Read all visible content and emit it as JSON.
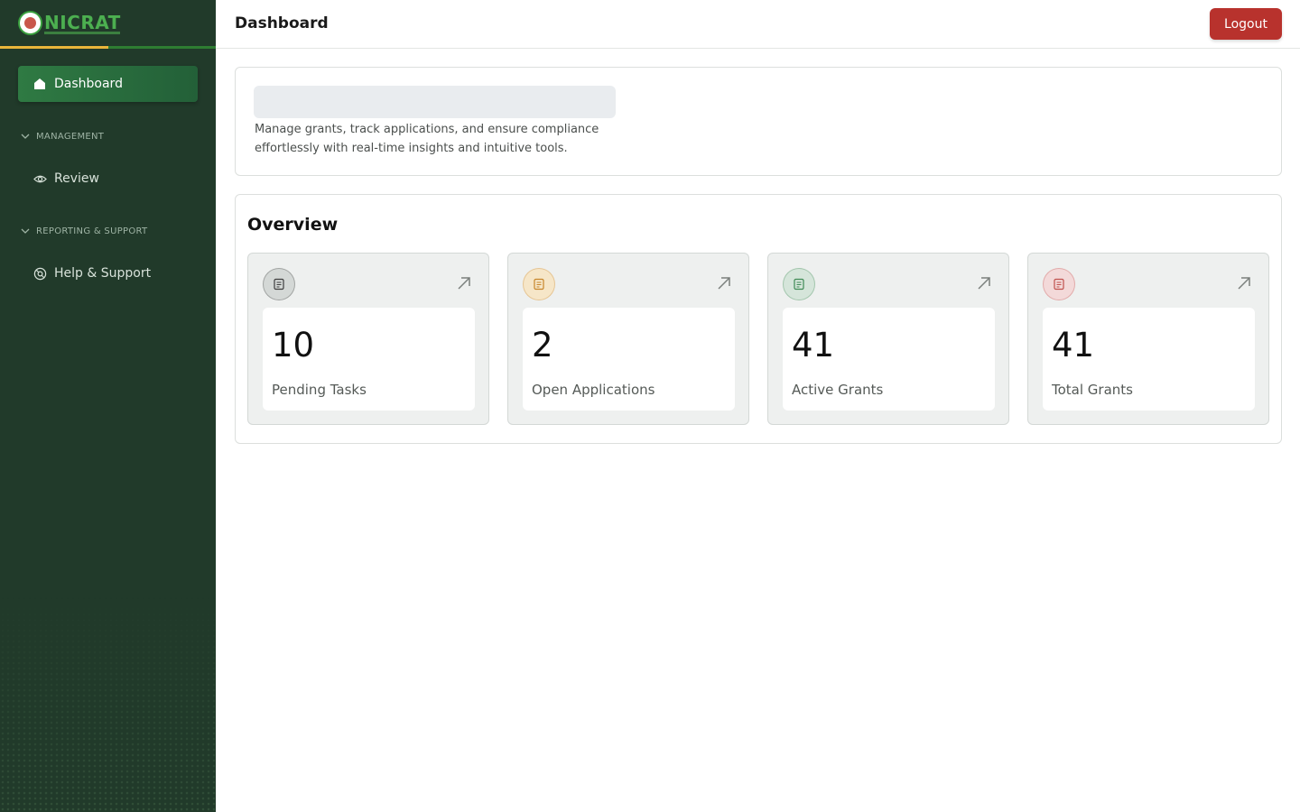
{
  "brand": {
    "name": "NICRAT"
  },
  "sidebar": {
    "active_item": {
      "label": "Dashboard",
      "icon": "home-icon"
    },
    "sections": [
      {
        "title": "MANAGEMENT",
        "items": [
          {
            "label": "Review",
            "icon": "eye-icon"
          }
        ]
      },
      {
        "title": "REPORTING & SUPPORT",
        "items": [
          {
            "label": "Help & Support",
            "icon": "support-icon"
          }
        ]
      }
    ]
  },
  "header": {
    "title": "Dashboard",
    "logout_label": "Logout"
  },
  "welcome": {
    "description": "Manage grants, track applications, and ensure compliance effortlessly with real-time insights and intuitive tools."
  },
  "overview": {
    "title": "Overview",
    "cards": [
      {
        "value": "10",
        "label": "Pending Tasks",
        "badge_color": "#d4d8d6",
        "icon_color": "#3d3d3d"
      },
      {
        "value": "2",
        "label": "Open Applications",
        "badge_color": "#f6e6c8",
        "icon_color": "#c7852a"
      },
      {
        "value": "41",
        "label": "Active Grants",
        "badge_color": "#d5e5da",
        "icon_color": "#3f8a55"
      },
      {
        "value": "41",
        "label": "Total Grants",
        "badge_color": "#f3d9d9",
        "icon_color": "#c0504d"
      }
    ]
  },
  "colors": {
    "sidebar_bg": "#213a2a",
    "accent_green": "#2f7a43",
    "logout_red": "#b8322d"
  }
}
